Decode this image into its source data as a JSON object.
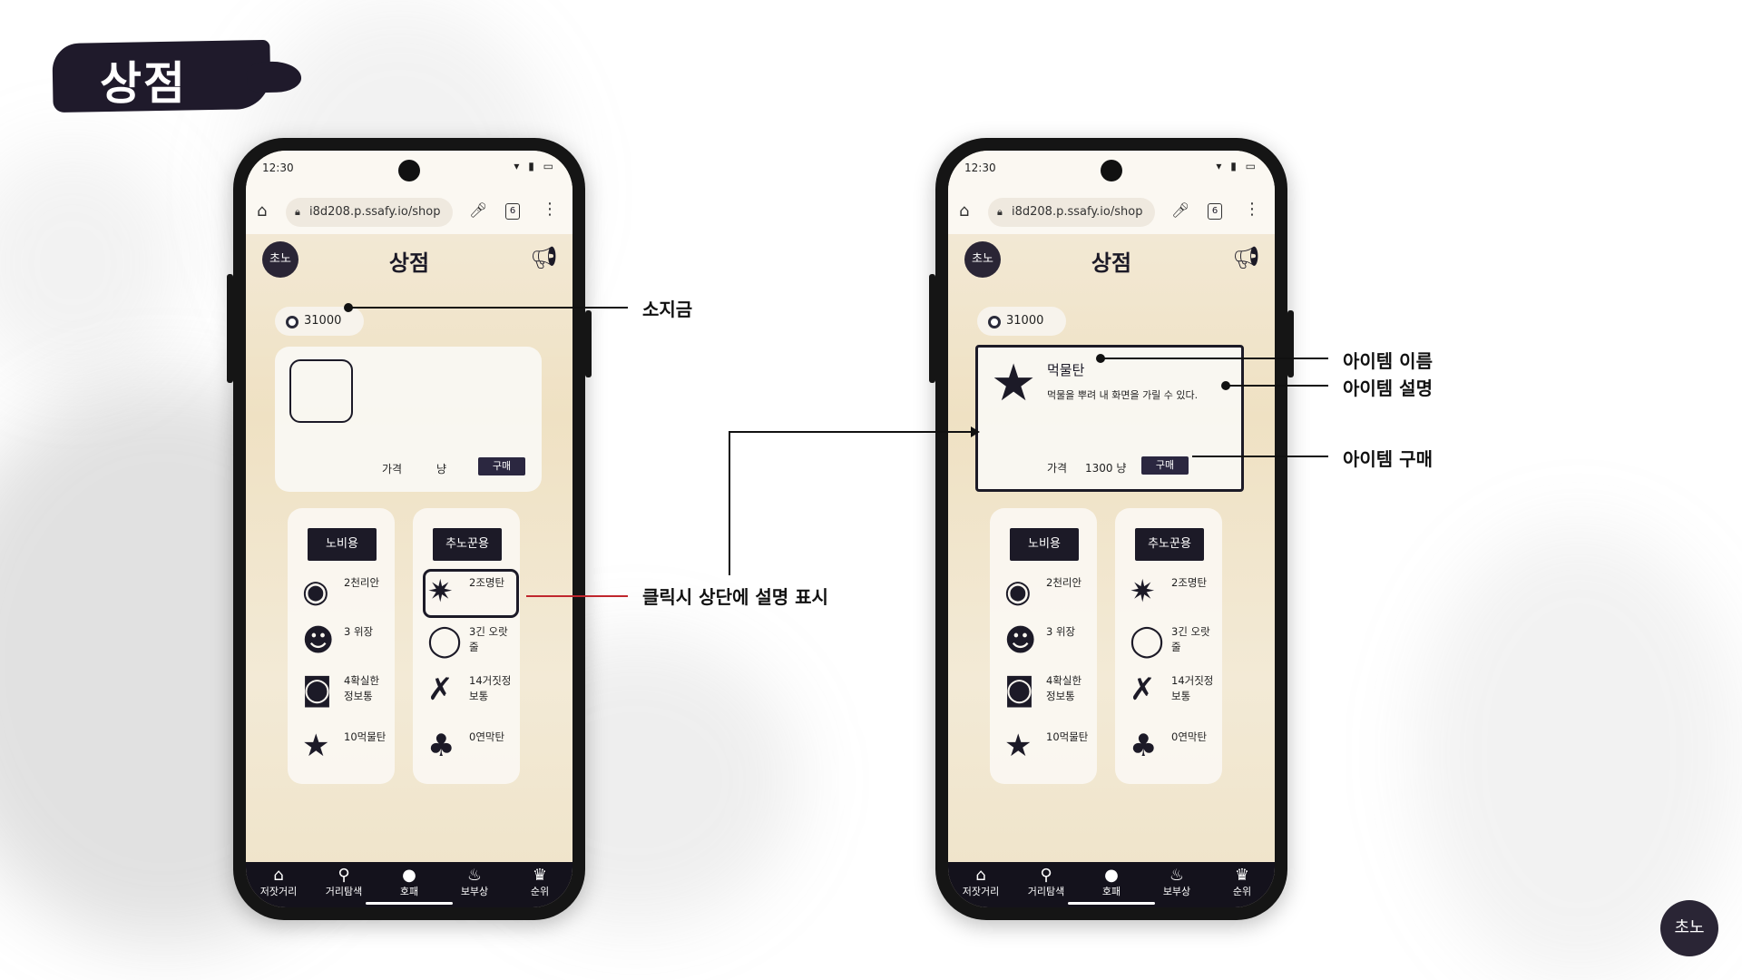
{
  "page_title": "상점",
  "corner_logo": "초노",
  "phones": [
    {
      "status_time": "12:30",
      "status_icons": "▾ ▮ ▭",
      "url": "i8d208.p.ssafy.io/shop",
      "tab_count": "6",
      "app_logo": "초노",
      "app_title": "상점",
      "money": "31000",
      "detail": {
        "price_label": "가격",
        "price_unit": "냥",
        "buy_label": "구매"
      }
    },
    {
      "status_time": "12:30",
      "status_icons": "▾ ▮ ▭",
      "url": "i8d208.p.ssafy.io/shop",
      "tab_count": "6",
      "app_logo": "초노",
      "app_title": "상점",
      "money": "31000",
      "detail": {
        "name": "먹물탄",
        "description": "먹물을 뿌려 내 화면을 가릴 수 있다.",
        "price_label": "가격",
        "price_value": "1300 냥",
        "buy_label": "구매"
      }
    }
  ],
  "columns": [
    {
      "header": "노비용",
      "items": [
        {
          "icon": "eye-icon",
          "glyph": "◉",
          "label": "2천리안"
        },
        {
          "icon": "mask-icon",
          "glyph": "☻",
          "label": "3 위장"
        },
        {
          "icon": "magnifier-icon",
          "glyph": "◙",
          "label": "4확실한 정보통"
        },
        {
          "icon": "ink-splat-icon",
          "glyph": "★",
          "label": "10먹물탄"
        }
      ]
    },
    {
      "header": "추노꾼용",
      "items": [
        {
          "icon": "flash-icon",
          "glyph": "✷",
          "label": "2조명탄"
        },
        {
          "icon": "speech-bubble-icon",
          "glyph": "◯",
          "label": "3긴 오랏줄"
        },
        {
          "icon": "false-info-icon",
          "glyph": "✗",
          "label": "14거짓정보통"
        },
        {
          "icon": "smoke-bomb-icon",
          "glyph": "♣",
          "label": "0연막탄"
        }
      ]
    }
  ],
  "nav": [
    {
      "icon": "house-icon",
      "glyph": "⌂",
      "label": "저잣거리"
    },
    {
      "icon": "search-icon",
      "glyph": "⚲",
      "label": "거리탐색"
    },
    {
      "icon": "person-icon",
      "glyph": "●",
      "label": "호패"
    },
    {
      "icon": "pouch-icon",
      "glyph": "♨",
      "label": "보부상"
    },
    {
      "icon": "trophy-icon",
      "glyph": "♛",
      "label": "순위"
    }
  ],
  "annotations": {
    "money": "소지금",
    "click_hint": "클릭시 상단에 설명 표시",
    "item_name": "아이템 이름",
    "item_desc": "아이템 설명",
    "item_buy": "아이템 구매"
  },
  "colors": {
    "ink": "#1c1a27",
    "paper": "#efe1c3",
    "highlight_line": "#c0262d"
  }
}
